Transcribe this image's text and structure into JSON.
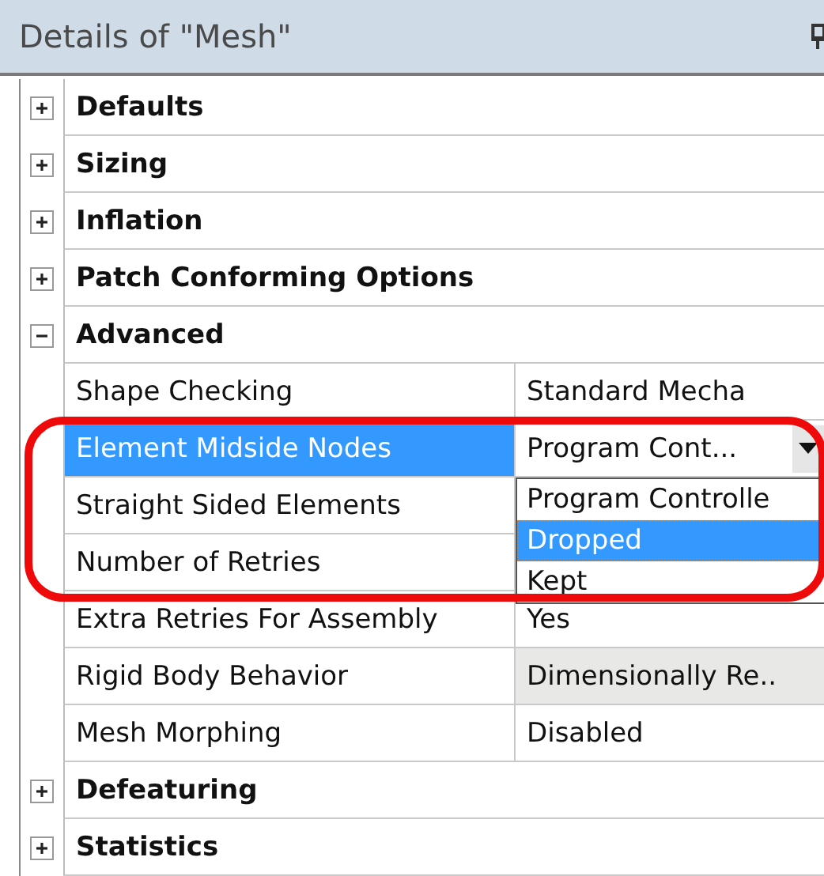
{
  "panel": {
    "title": "Details of \"Mesh\""
  },
  "groups": [
    {
      "label": "Defaults",
      "expanded": false
    },
    {
      "label": "Sizing",
      "expanded": false
    },
    {
      "label": "Inflation",
      "expanded": false
    },
    {
      "label": "Patch Conforming Options",
      "expanded": false
    },
    {
      "label": "Advanced",
      "expanded": true,
      "properties": [
        {
          "name": "Shape Checking",
          "value": "Standard Mecha",
          "kind": "text",
          "selected": false
        },
        {
          "name": "Element Midside Nodes",
          "value": "Program Cont...",
          "kind": "dropdown",
          "selected": true,
          "open": true,
          "options": [
            {
              "label": "Program Controlle",
              "selected": false
            },
            {
              "label": "Dropped",
              "selected": true
            },
            {
              "label": "Kept",
              "selected": false
            }
          ]
        },
        {
          "name": "Straight Sided Elements",
          "kind": "covered",
          "selected": false
        },
        {
          "name": "Number of Retries",
          "kind": "covered",
          "selected": false
        },
        {
          "name": "Extra Retries For Assembly",
          "value": "Yes",
          "kind": "text",
          "selected": false
        },
        {
          "name": "Rigid Body Behavior",
          "value": "Dimensionally Re..",
          "kind": "text",
          "selected": false,
          "shaded": true
        },
        {
          "name": "Mesh Morphing",
          "value": "Disabled",
          "kind": "text",
          "selected": false
        }
      ]
    },
    {
      "label": "Defeaturing",
      "expanded": false
    },
    {
      "label": "Statistics",
      "expanded": false
    }
  ]
}
